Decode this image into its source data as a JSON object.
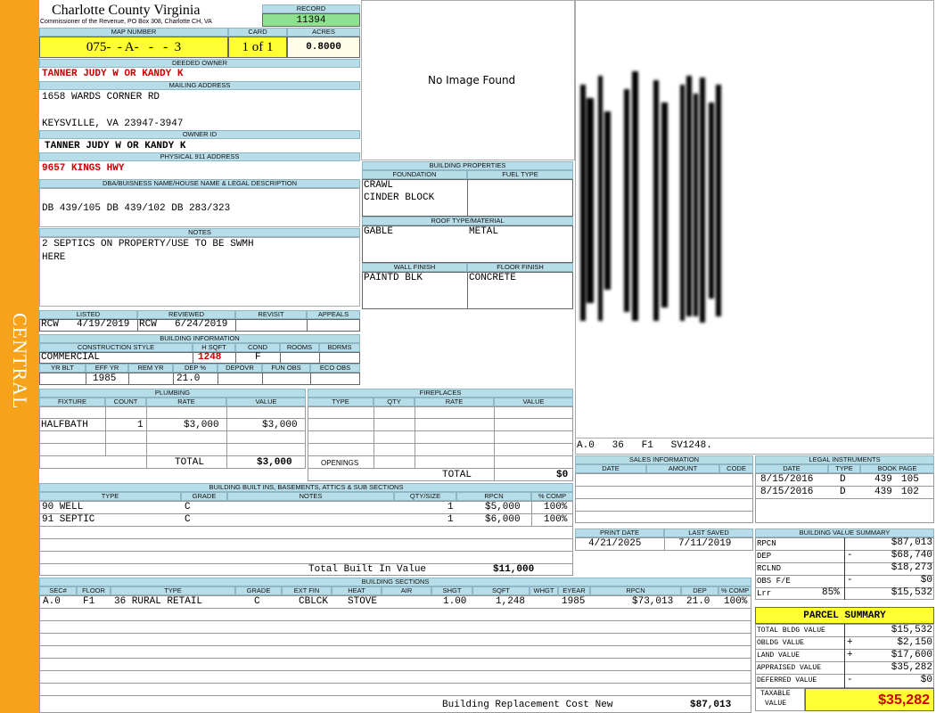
{
  "side_label": "CENTRAL",
  "header": {
    "county": "Charlotte County Virginia",
    "commissioner": "Commissioner of the Revenue, PO Box 308, Charlotte CH, VA",
    "record_label": "RECORD",
    "record": "11394",
    "map_label": "MAP NUMBER",
    "map": "075-  - A-   -   -  3",
    "card_label": "CARD",
    "card": "1 of 1",
    "acres_label": "ACRES",
    "acres": "0.8000"
  },
  "owner": {
    "deeded_label": "DEEDED OWNER",
    "deeded": "TANNER JUDY W OR KANDY K",
    "mailing_label": "MAILING ADDRESS",
    "addr1": "1658 WARDS CORNER RD",
    "addr2": "KEYSVILLE, VA 23947-3947",
    "ownerid_label": "OWNER ID",
    "ownerid": "TANNER JUDY W OR KANDY K",
    "phys_label": "PHYSICAL 911 ADDRESS",
    "phys": "9657 KINGS HWY"
  },
  "legal": {
    "label": "DBA/BUISNESS NAME/HOUSE NAME & LEGAL DESCRIPTION",
    "text": "DB 439/105 DB 439/102 DB 283/323"
  },
  "notes": {
    "label": "NOTES",
    "line1": "2 SEPTICS ON PROPERTY/USE TO BE SWMH",
    "line2": "HERE"
  },
  "image": {
    "no_image": "No Image Found"
  },
  "building_props": {
    "label": "BUILDING PROPERTIES",
    "foundation_label": "FOUNDATION",
    "fuel_label": "FUEL TYPE",
    "foundation1": "CRAWL",
    "foundation2": "CINDER BLOCK",
    "roof_label": "ROOF TYPE/MATERIAL",
    "roof_type": "GABLE",
    "roof_material": "METAL",
    "wall_label": "WALL FINISH",
    "floor_label": "FLOOR FINISH",
    "wall": "PAINTD BLK",
    "floor": "CONCRETE"
  },
  "sketch": {
    "caption": "A.0   36   F1   SV1248."
  },
  "listed": {
    "listed_label": "LISTED",
    "reviewed_label": "REVIEWED",
    "revisit_label": "REVISIT",
    "appeals_label": "APPEALS",
    "listed_by": "RCW",
    "listed_date": "4/19/2019",
    "reviewed_by": "RCW",
    "reviewed_date": "6/24/2019"
  },
  "building_info": {
    "label": "BUILDING INFORMATION",
    "style_label": "CONSTRUCTION STYLE",
    "hsqft_label": "H SQFT",
    "cond_label": "COND",
    "rooms_label": "ROOMS",
    "bdrms_label": "BDRMS",
    "style": "COMMERCIAL",
    "hsqft": "1248",
    "cond": "F",
    "yrblt_label": "YR BLT",
    "effyr_label": "EFF YR",
    "remyr_label": "REM YR",
    "dep_label": "DEP %",
    "depovr_label": "DEPOVR",
    "funobs_label": "FUN OBS",
    "ecoobs_label": "ECO OBS",
    "effyr": "1985",
    "dep": "21.0"
  },
  "plumbing": {
    "label": "PLUMBING",
    "fixture_label": "FIXTURE",
    "count_label": "COUNT",
    "rate_label": "RATE",
    "value_label": "VALUE",
    "fixture": "HALFBATH",
    "count": "1",
    "rate": "$3,000",
    "value": "$3,000",
    "total_label": "TOTAL",
    "total": "$3,000"
  },
  "fireplaces": {
    "label": "FIREPLACES",
    "type_label": "TYPE",
    "qty_label": "QTY",
    "rate_label": "RATE",
    "value_label": "VALUE",
    "openings_label": "OPENINGS",
    "total_label": "TOTAL",
    "total": "$0"
  },
  "sales": {
    "label": "SALES INFORMATION",
    "date_label": "DATE",
    "amount_label": "AMOUNT",
    "code_label": "CODE"
  },
  "legal_instruments": {
    "label": "LEGAL INSTRUMENTS",
    "date_label": "DATE",
    "type_label": "TYPE",
    "bookpage_label": "BOOK PAGE",
    "rows": [
      {
        "date": "8/15/2016",
        "type": "D",
        "book": "439",
        "page": "105"
      },
      {
        "date": "8/15/2016",
        "type": "D",
        "book": "439",
        "page": "102"
      }
    ]
  },
  "builtins": {
    "label": "BUILDING BUILT INS, BASEMENTS, ATTICS & SUB SECTIONS",
    "type_label": "TYPE",
    "grade_label": "GRADE",
    "notes_label": "NOTES",
    "qty_label": "QTY/SIZE",
    "rpcn_label": "RPCN",
    "comp_label": "% COMP",
    "rows": [
      {
        "type": "90 WELL",
        "grade": "C",
        "qty": "1",
        "rpcn": "$5,000",
        "comp": "100%"
      },
      {
        "type": "91 SEPTIC",
        "grade": "C",
        "qty": "1",
        "rpcn": "$6,000",
        "comp": "100%"
      }
    ],
    "total_label": "Total Built In Value",
    "total": "$11,000"
  },
  "print": {
    "print_label": "PRINT DATE",
    "saved_label": "LAST SAVED",
    "print_date": "4/21/2025",
    "saved_date": "7/11/2019"
  },
  "value_summary": {
    "label": "BUILDING VALUE SUMMARY",
    "rows": [
      {
        "label": "RPCN",
        "op": "",
        "value": "$87,013"
      },
      {
        "label": "DEP",
        "op": "-",
        "value": "$68,740"
      },
      {
        "label": "RCLND",
        "op": "",
        "value": "$18,273"
      },
      {
        "label": "OBS F/E",
        "op": "-",
        "value": "$0"
      },
      {
        "label": "Lrr",
        "op": "85%",
        "value": "$15,532"
      }
    ]
  },
  "parcel": {
    "title": "PARCEL SUMMARY",
    "rows": [
      {
        "label": "TOTAL BLDG VALUE",
        "op": "",
        "value": "$15,532"
      },
      {
        "label": "OBLDG VALUE",
        "op": "+",
        "value": "$2,150"
      },
      {
        "label": "LAND VALUE",
        "op": "+",
        "value": "$17,600"
      },
      {
        "label": "APPRAISED VALUE",
        "op": "",
        "value": "$35,282"
      },
      {
        "label": "DEFERRED VALUE",
        "op": "-",
        "value": "$0"
      }
    ],
    "taxable_label1": "TAXABLE",
    "taxable_label2": "VALUE",
    "taxable": "$35,282"
  },
  "sections": {
    "label": "BUILDING SECTIONS",
    "sec_label": "SEC#",
    "floor_label": "FLOOR",
    "type_label": "TYPE",
    "grade_label": "GRADE",
    "extfin_label": "EXT FIN",
    "heat_label": "HEAT",
    "air_label": "AIR",
    "shgt_label": "SHGT",
    "sqft_label": "SQFT",
    "whgt_label": "WHGT",
    "eyear_label": "EYEAR",
    "rpcn_label": "RPCN",
    "dep_label": "DEP",
    "comp_label": "% COMP",
    "row": {
      "sec": "A.0",
      "floor": "F1",
      "type": "36 RURAL RETAIL",
      "grade": "C",
      "extfin": "CBLCK",
      "heat": "STOVE",
      "shgt": "1.00",
      "sqft": "1,248",
      "eyear": "1985",
      "rpcn": "$73,013",
      "dep": "21.0",
      "comp": "100%"
    },
    "total_label": "Building Replacement Cost New",
    "total": "$87,013"
  }
}
